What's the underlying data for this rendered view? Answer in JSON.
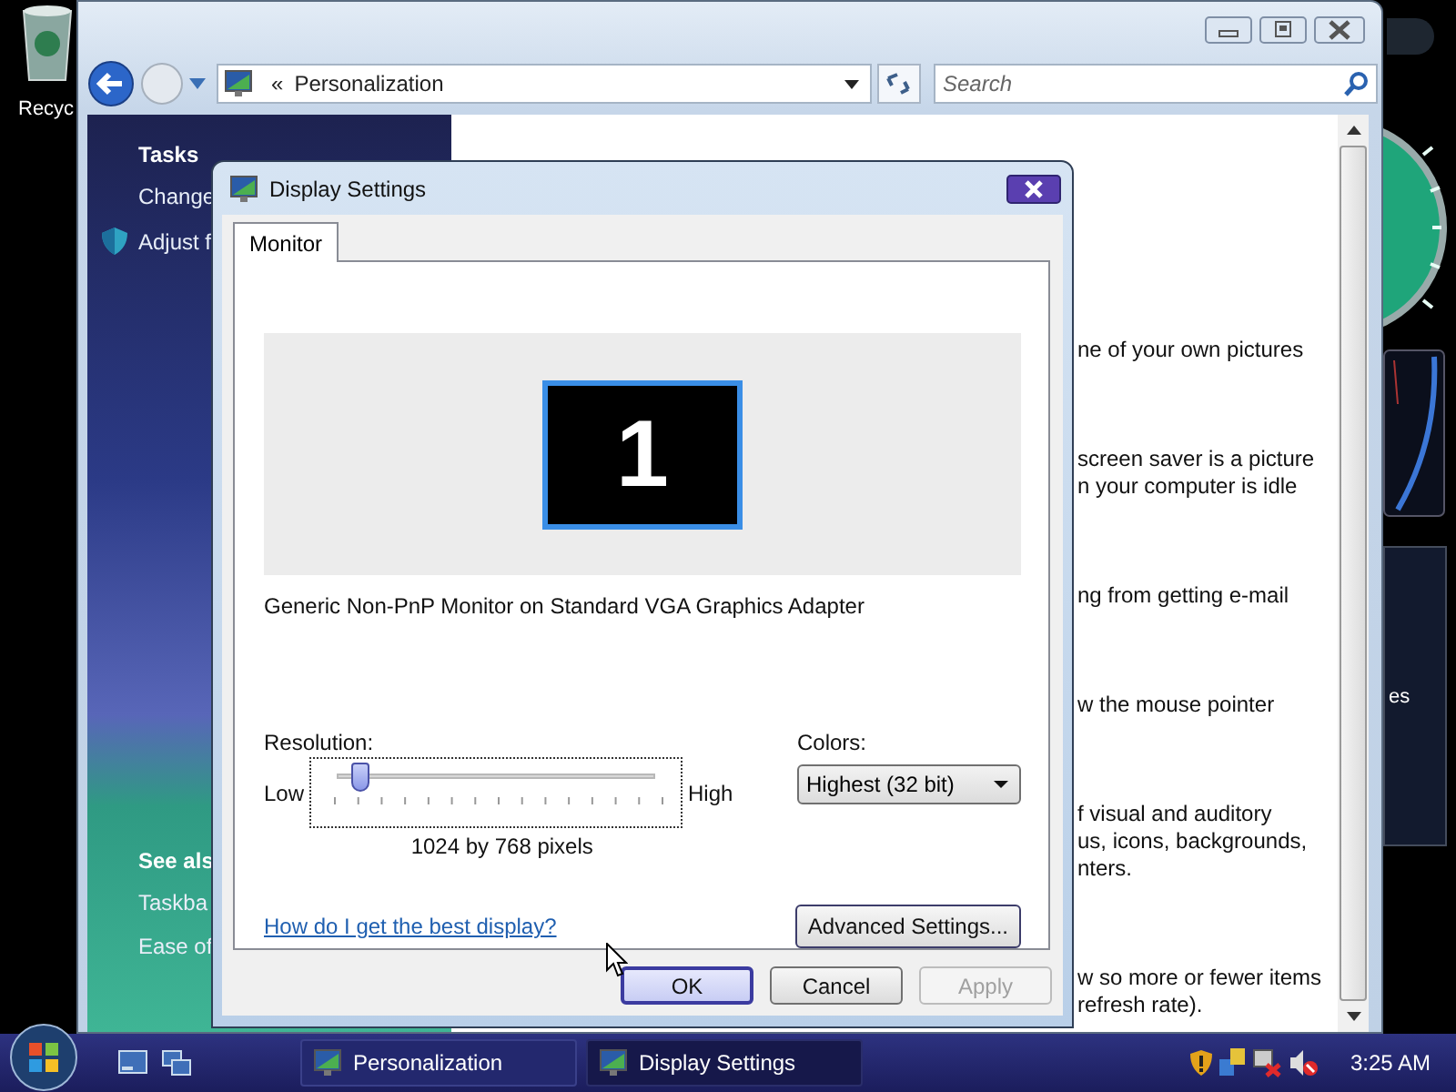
{
  "desktop": {
    "icons": [
      {
        "label": "Recyc"
      }
    ],
    "gadgets": [
      {
        "kind": "clock"
      },
      {
        "kind": "picture"
      },
      {
        "kind": "feed",
        "label": "es"
      }
    ]
  },
  "explorer": {
    "address": {
      "chevron": "«",
      "location": "Personalization"
    },
    "search": {
      "placeholder": "Search"
    },
    "sidebar": {
      "tasks_heading": "Tasks",
      "tasks": [
        {
          "label": "Change",
          "kind": "plain"
        },
        {
          "label": "Adjust f",
          "kind": "shield"
        }
      ],
      "see_also_heading": "See als",
      "see_also": [
        {
          "label": "Taskba"
        },
        {
          "label": "Ease of"
        }
      ]
    },
    "content": [
      {
        "lines": [
          "ne of your own pictures"
        ]
      },
      {
        "lines": [
          "screen saver is a picture",
          "n your computer is idle"
        ]
      },
      {
        "lines": [
          "ng from getting e-mail"
        ]
      },
      {
        "lines": [
          "w the mouse pointer"
        ]
      },
      {
        "lines": [
          "f visual and auditory",
          "us, icons, backgrounds,",
          "nters."
        ]
      },
      {
        "lines": [
          "w so more or fewer items",
          "refresh rate)."
        ]
      }
    ]
  },
  "dialog": {
    "title": "Display Settings",
    "tabs": [
      {
        "label": "Monitor",
        "selected": true
      }
    ],
    "monitors": [
      {
        "number": "1",
        "selected": true
      }
    ],
    "monitor_name": "Generic Non-PnP Monitor on Standard VGA Graphics Adapter",
    "resolution": {
      "label": "Resolution:",
      "low": "Low",
      "high": "High",
      "level": 0.07,
      "reading": "1024 by 768 pixels"
    },
    "colors": {
      "label": "Colors:",
      "value": "Highest (32 bit)"
    },
    "help_link": "How do I get the best display?",
    "advanced_button": "Advanced Settings...",
    "buttons": [
      {
        "label": "OK",
        "default": true,
        "disabled": false
      },
      {
        "label": "Cancel",
        "default": false,
        "disabled": false
      },
      {
        "label": "Apply",
        "default": false,
        "disabled": true
      }
    ]
  },
  "taskbar": {
    "tasks": [
      {
        "label": "Personalization",
        "selected": false
      },
      {
        "label": "Display Settings",
        "selected": true
      }
    ],
    "clock": "3:25 AM"
  }
}
